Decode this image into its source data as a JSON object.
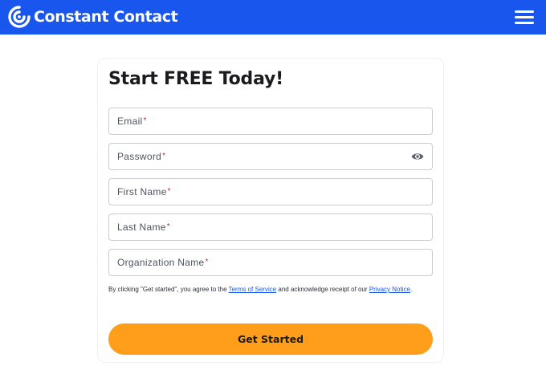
{
  "header": {
    "brand_name": "Constant Contact",
    "bg_color": "#1856ed",
    "logo_icon": "constant-contact-logo-icon",
    "menu_icon": "hamburger-menu-icon"
  },
  "form": {
    "title": "Start FREE Today!",
    "fields": [
      {
        "label": "Email",
        "required_mark": "*"
      },
      {
        "label": "Password",
        "required_mark": "*",
        "icon": "eye-icon"
      },
      {
        "label": "First Name",
        "required_mark": "*"
      },
      {
        "label": "Last Name",
        "required_mark": "*"
      },
      {
        "label": "Organization Name",
        "required_mark": "*"
      }
    ],
    "legal": {
      "prefix": "By clicking \"Get started\", you agree to the ",
      "terms_link": "Terms of Service",
      "middle": " and acknowledge receipt of our ",
      "privacy_link": "Privacy Notice",
      "suffix": "."
    },
    "submit_label": "Get Started",
    "accent_color": "#ff9e1b",
    "link_color": "#1856ed",
    "required_color": "#d8252f"
  }
}
